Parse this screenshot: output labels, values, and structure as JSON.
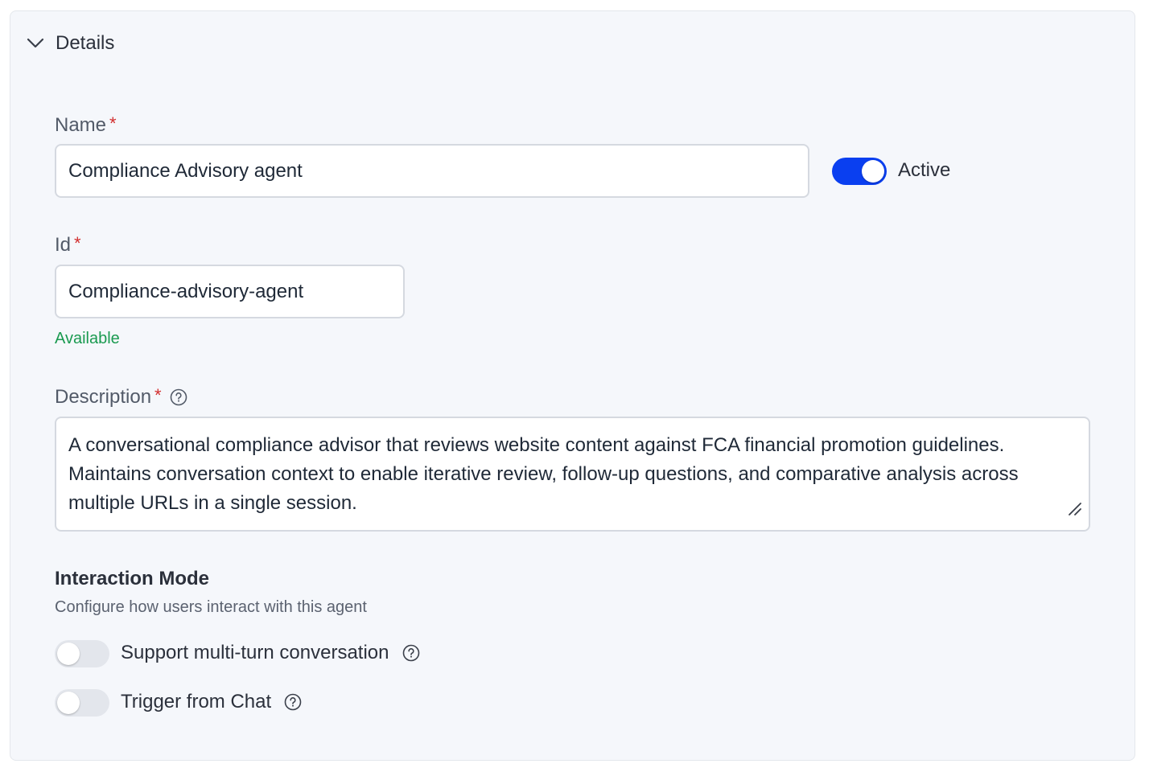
{
  "section": {
    "title": "Details",
    "expanded": true
  },
  "name": {
    "label": "Name",
    "required_mark": "*",
    "value": "Compliance Advisory agent"
  },
  "active": {
    "label": "Active",
    "on": true
  },
  "id": {
    "label": "Id",
    "required_mark": "*",
    "value": "Compliance-advisory-agent",
    "status": "Available"
  },
  "description": {
    "label": "Description",
    "required_mark": "*",
    "value": "A conversational compliance advisor that reviews website content against FCA financial promotion guidelines. Maintains conversation context to enable iterative review, follow-up questions, and comparative analysis across multiple URLs in a single session."
  },
  "interaction_mode": {
    "title": "Interaction Mode",
    "description": "Configure how users interact with this agent",
    "options": [
      {
        "label": "Support multi-turn conversation",
        "on": false
      },
      {
        "label": "Trigger from Chat",
        "on": false
      }
    ]
  },
  "colors": {
    "accent": "#0a3ff0",
    "required": "#d22e2e",
    "available": "#1a9a50"
  },
  "icons": {
    "collapse": "chevron-down-icon",
    "help": "question-circle-icon",
    "resize": "resize-grip-icon"
  }
}
